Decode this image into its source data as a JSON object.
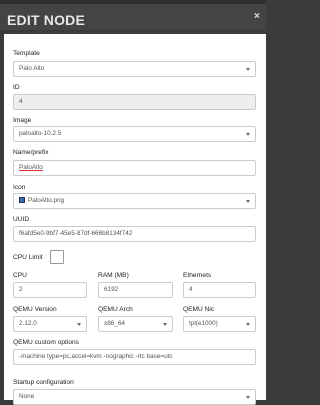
{
  "window": {
    "title": "EDIT NODE",
    "close_glyph": "×"
  },
  "form": {
    "template": {
      "label": "Template",
      "value": "Palo Alto"
    },
    "id": {
      "label": "ID",
      "value": "4"
    },
    "image": {
      "label": "Image",
      "value": "paloalto-10.2.5"
    },
    "name": {
      "label": "Name/prefix",
      "value": "PaloAlto"
    },
    "icon": {
      "label": "Icon",
      "value": "PaloAlto.png"
    },
    "uuid": {
      "label": "UUID",
      "value": "f6afd5e0-9bf7-45e5-87df-666b8134f742"
    },
    "cpu_limit": {
      "label": "CPU Limit"
    },
    "cpu": {
      "label": "CPU",
      "value": "2"
    },
    "ram": {
      "label": "RAM (MB)",
      "value": "6192"
    },
    "ethernets": {
      "label": "Ethernets",
      "value": "4"
    },
    "qemu_version": {
      "label": "QEMU Version",
      "value": "2.12.0"
    },
    "qemu_arch": {
      "label": "QEMU Arch",
      "value": "x86_64"
    },
    "qemu_nic": {
      "label": "QEMU Nic",
      "value": "tpl(e1000)"
    },
    "qemu_options": {
      "label": "QEMU custom options",
      "value": "-machine type=pc,accel=kvm -nographic -rtc base=utc"
    },
    "startup_config": {
      "label": "Startup configuration",
      "value": "None"
    }
  }
}
